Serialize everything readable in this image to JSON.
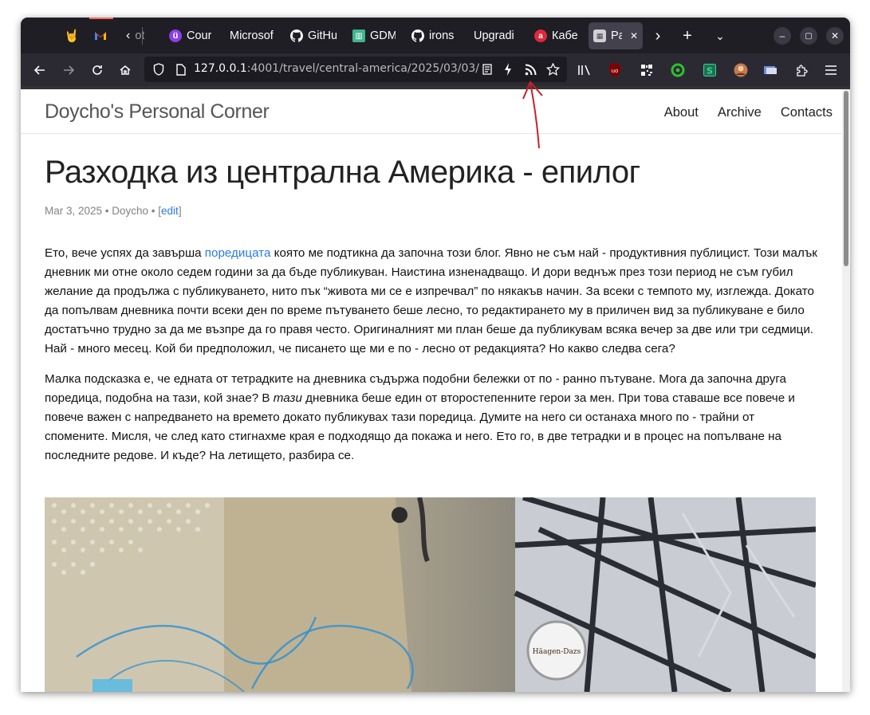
{
  "browser": {
    "tabs": [
      {
        "label": "",
        "icon": "hand-rock-icon"
      },
      {
        "label": "",
        "icon": "gmail-icon"
      },
      {
        "label": "ot",
        "icon": "scroll-left-icon"
      },
      {
        "label": "Cour",
        "icon": "course-icon"
      },
      {
        "label": "Microsof",
        "icon": ""
      },
      {
        "label": "GitHu",
        "icon": "github-icon"
      },
      {
        "label": "GDM",
        "icon": "gdm-icon"
      },
      {
        "label": "irons",
        "icon": "github-icon"
      },
      {
        "label": "Upgradi",
        "icon": ""
      },
      {
        "label": "Кабе",
        "icon": "kabe-icon"
      },
      {
        "label": "Pa",
        "icon": "page-icon"
      }
    ],
    "active_tab_close": "✕",
    "new_tab": "+",
    "url": {
      "host": "127.0.0.1",
      "path": ":4001/travel/central-america/2025/03/03/"
    }
  },
  "site": {
    "title": "Doycho's Personal Corner",
    "nav": [
      "About",
      "Archive",
      "Contacts"
    ]
  },
  "post": {
    "title": "Разходка из централна Америка - епилог",
    "meta_prefix": "Mar 3, 2025 • Doycho • [",
    "meta_edit": "edit",
    "meta_suffix": "]",
    "p1_before_link": "Ето, вече успях да завърша ",
    "p1_link": "поредицата",
    "p1_after_link": " която ме подтикна да започна този блог. Явно не съм най - продуктивния публицист. Този малък дневник ми отне около седем години за да бъде публикуван. Наистина изненадващо. И дори веднъж през този период не съм губил желание да продължа с публикуването, нито пък “живота ми се е изпречвал” по някакъв начин. За всеки с темпото му, изглежда. Докато да попълвам дневника почти всеки ден по време пътуването беше лесно, то редактирането му в приличен вид за публикуване е било достатъчно трудно за да ме възпре да го правя често. Оригиналният ми план беше да публикувам всяка вечер за две или три седмици. Най - много месец. Кой би предположил, че писането ще ми е по - лесно от редакцията? Но какво следва сега?",
    "p2_before_em": "Малка подсказка е, че едната от тетрадките на дневника съдържа подобни бележки от по - ранно пътуване. Мога да започна друга поредица, подобна на тази, кой знае? В ",
    "p2_em": "тази",
    "p2_after_em": " дневника беше един от второстепенните герои за мен. При това ставаше все повече и повече важен с напредването на времето докато публикувах тази поредица. Думите на него си останаха много по - трайни от спомените. Мисля, че след като стигнахме края е подходящо да покажа и него. Ето го, в две тетрадки и в процес на попълване на последните редове. И къде? На летището, разбира се.",
    "photo_sign_text": "Häagen-Dazs"
  },
  "colors": {
    "link": "#2a7ae2",
    "annotation_arrow": "#c8202a",
    "browser_chrome": "#2b2a33"
  }
}
